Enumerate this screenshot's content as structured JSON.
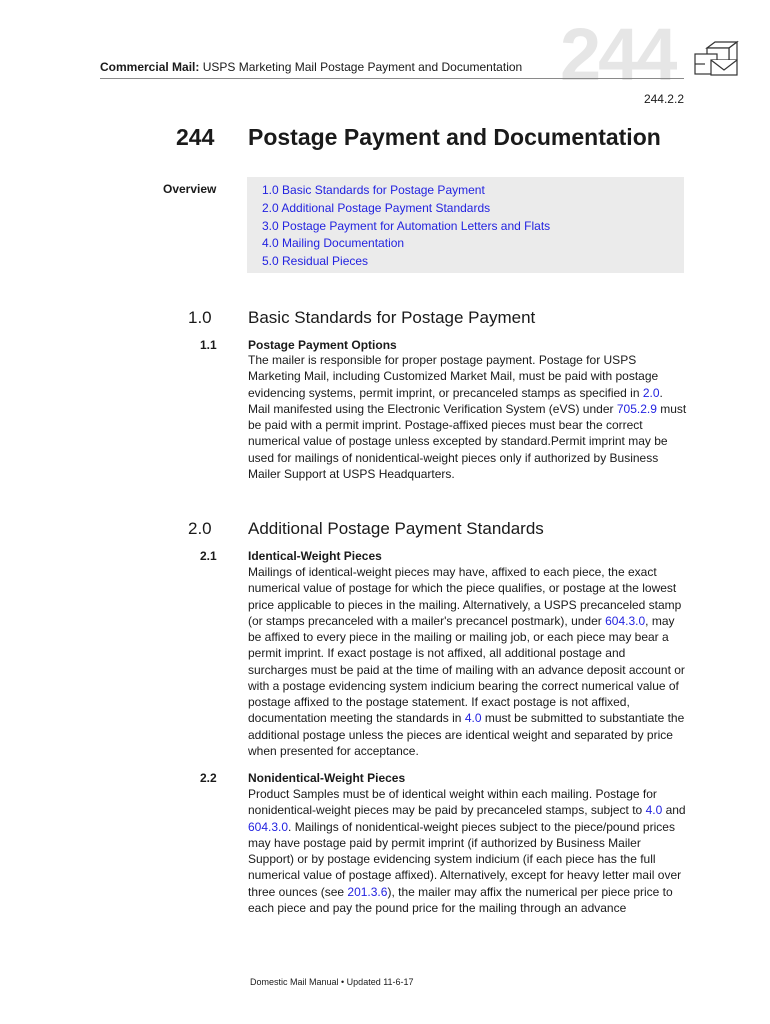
{
  "header": {
    "running_head_bold": "Commercial Mail:",
    "running_head_rest": " USPS Marketing Mail Postage Payment and Documentation",
    "chapter_watermark": "244",
    "section_ref": "244.2.2",
    "icon": "mail-package-icon"
  },
  "chapter": {
    "number": "244",
    "title": "Postage Payment and Documentation"
  },
  "overview": {
    "label": "Overview",
    "items": [
      {
        "label": "1.0 Basic Standards for Postage Payment"
      },
      {
        "label": "2.0 Additional Postage Payment Standards"
      },
      {
        "label": "3.0 Postage Payment for Automation Letters and Flats"
      },
      {
        "label": "4.0 Mailing Documentation"
      },
      {
        "label": "5.0 Residual Pieces"
      }
    ]
  },
  "sections": [
    {
      "number": "1.0",
      "title": "Basic Standards for Postage Payment",
      "subsections": [
        {
          "number": "1.1",
          "title": "Postage Payment Options",
          "text": [
            "The mailer is responsible for proper postage payment. Postage for USPS Marketing Mail, including Customized Market Mail, must be paid with postage evidencing systems, permit imprint, or precanceled stamps as specified in ",
            "2.0",
            ". Mail manifested using the Electronic Verification System (eVS) under ",
            "705.2.9",
            " must be paid with a permit imprint. Postage-affixed pieces must bear the correct numerical value of postage unless excepted by standard.Permit imprint may be used for mailings of nonidentical-weight pieces only if authorized by Business Mailer Support at USPS Headquarters."
          ]
        }
      ]
    },
    {
      "number": "2.0",
      "title": "Additional Postage Payment Standards",
      "subsections": [
        {
          "number": "2.1",
          "title": "Identical-Weight Pieces",
          "text": [
            "Mailings of identical-weight pieces may have, affixed to each piece, the exact numerical value of postage for which the piece qualifies, or postage at the lowest price applicable to pieces in the mailing. Alternatively, a USPS precanceled stamp (or stamps precanceled with a mailer's precancel postmark), under ",
            "604.3.0",
            ", may be affixed to every piece in the mailing or mailing job, or each piece may bear a permit imprint. If exact postage is not affixed, all additional postage and surcharges must be paid at the time of mailing with an advance deposit account or with a postage evidencing system indicium bearing the correct numerical value of postage affixed to the postage statement. If exact postage is not affixed, documentation meeting the standards in ",
            "4.0",
            " must be submitted to substantiate the additional postage unless the pieces are identical weight and separated by price when presented for acceptance."
          ]
        },
        {
          "number": "2.2",
          "title": "Nonidentical-Weight Pieces",
          "text": [
            "Product Samples must be of identical weight within each mailing. Postage for nonidentical-weight pieces may be paid by precanceled stamps, subject to ",
            "4.0",
            " and ",
            "604.3.0",
            ". Mailings of nonidentical-weight pieces subject to the piece/pound prices may have postage paid by permit imprint (if authorized by Business Mailer Support) or by postage evidencing system indicium (if each piece has the full numerical value of postage affixed). Alternatively, except for heavy letter mail over three ounces (see ",
            "201.3.6",
            "), the mailer may affix the numerical per piece price to each piece and pay the pound price for the mailing through an advance"
          ]
        }
      ]
    }
  ],
  "footer": {
    "text": "Domestic Mail Manual • Updated 11-6-17"
  },
  "colors": {
    "link": "#2323e0",
    "overview_bg": "#ebebeb",
    "watermark": "#e6e6e6"
  }
}
